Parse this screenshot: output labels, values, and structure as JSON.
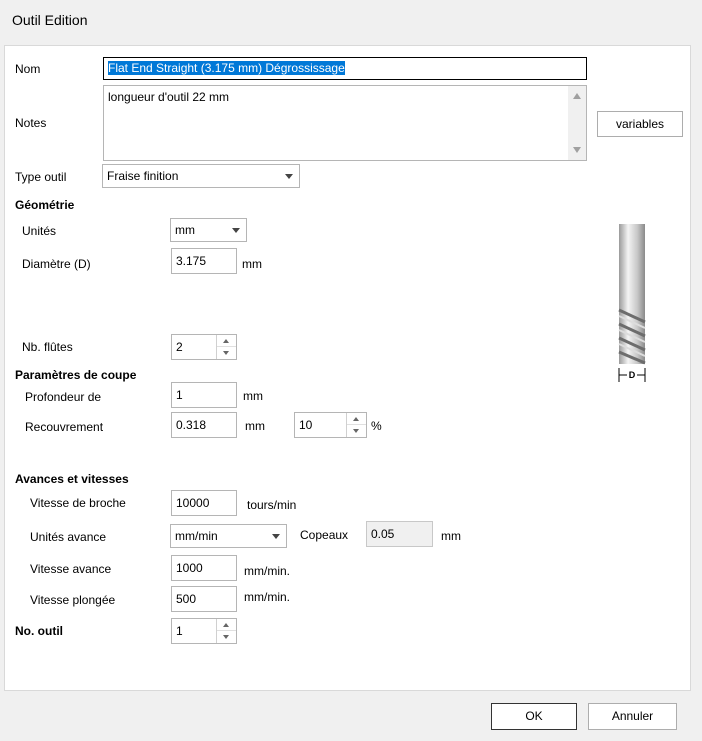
{
  "window": {
    "title": "Outil Edition"
  },
  "form": {
    "nom_label": "Nom",
    "nom_value": "Flat End Straight (3.175 mm) Dégrossissage",
    "notes_label": "Notes",
    "notes_value": "longueur d'outil 22 mm",
    "variables_button": "variables",
    "type_label": "Type outil",
    "type_value": "Fraise finition"
  },
  "geometry": {
    "heading": "Géométrie",
    "units_label": "Unités",
    "units_value": "mm",
    "diameter_label": "Diamètre (D)",
    "diameter_value": "3.175",
    "diameter_unit": "mm",
    "flutes_label": "Nb. flûtes",
    "flutes_value": "2",
    "diagram_label": "D"
  },
  "cutting": {
    "heading": "Paramètres de coupe",
    "depth_label": "Profondeur de",
    "depth_value": "1",
    "depth_unit": "mm",
    "overlap_label": "Recouvrement",
    "overlap_value": "0.318",
    "overlap_unit": "mm",
    "overlap_pct_value": "10",
    "overlap_pct_unit": "%"
  },
  "feeds": {
    "heading": "Avances et vitesses",
    "spindle_label": "Vitesse de broche",
    "spindle_value": "10000",
    "spindle_unit": "tours/min",
    "feed_units_label": "Unités avance",
    "feed_units_value": "mm/min",
    "chip_label": "Copeaux",
    "chip_value": "0.05",
    "chip_unit": "mm",
    "feed_label": "Vitesse avance",
    "feed_value": "1000",
    "feed_unit": "mm/min.",
    "plunge_label": "Vitesse plongée",
    "plunge_value": "500",
    "plunge_unit": "mm/min."
  },
  "tool_no": {
    "label": "No. outil",
    "value": "1"
  },
  "buttons": {
    "ok": "OK",
    "cancel": "Annuler"
  }
}
